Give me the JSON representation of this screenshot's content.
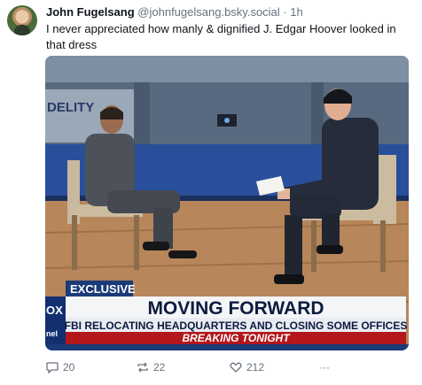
{
  "post": {
    "display_name": "John Fugelsang",
    "handle": "@johnfugelsang.bsky.social",
    "separator": "·",
    "time": "1h",
    "text": "I never appreciated how manly & dignified J. Edgar Hoover looked in that dress"
  },
  "media": {
    "wall_sign": "DELITY",
    "tag": "EXCLUSIVE",
    "headline": "MOVING FORWARD",
    "subhead": "FBI RELOCATING HEADQUARTERS AND CLOSING SOME OFFICES",
    "ticker": "BREAKING TONIGHT",
    "network_mark": "OX WS",
    "network_small": "nel"
  },
  "actions": {
    "replies": "20",
    "reposts": "22",
    "likes": "212",
    "more": "···",
    "icons": [
      "reply-icon",
      "repost-icon",
      "like-icon",
      "more-icon"
    ]
  },
  "colors": {
    "handle": "#66727f",
    "banner_blue": "#1a3a78",
    "ticker_red": "#b3161b"
  }
}
